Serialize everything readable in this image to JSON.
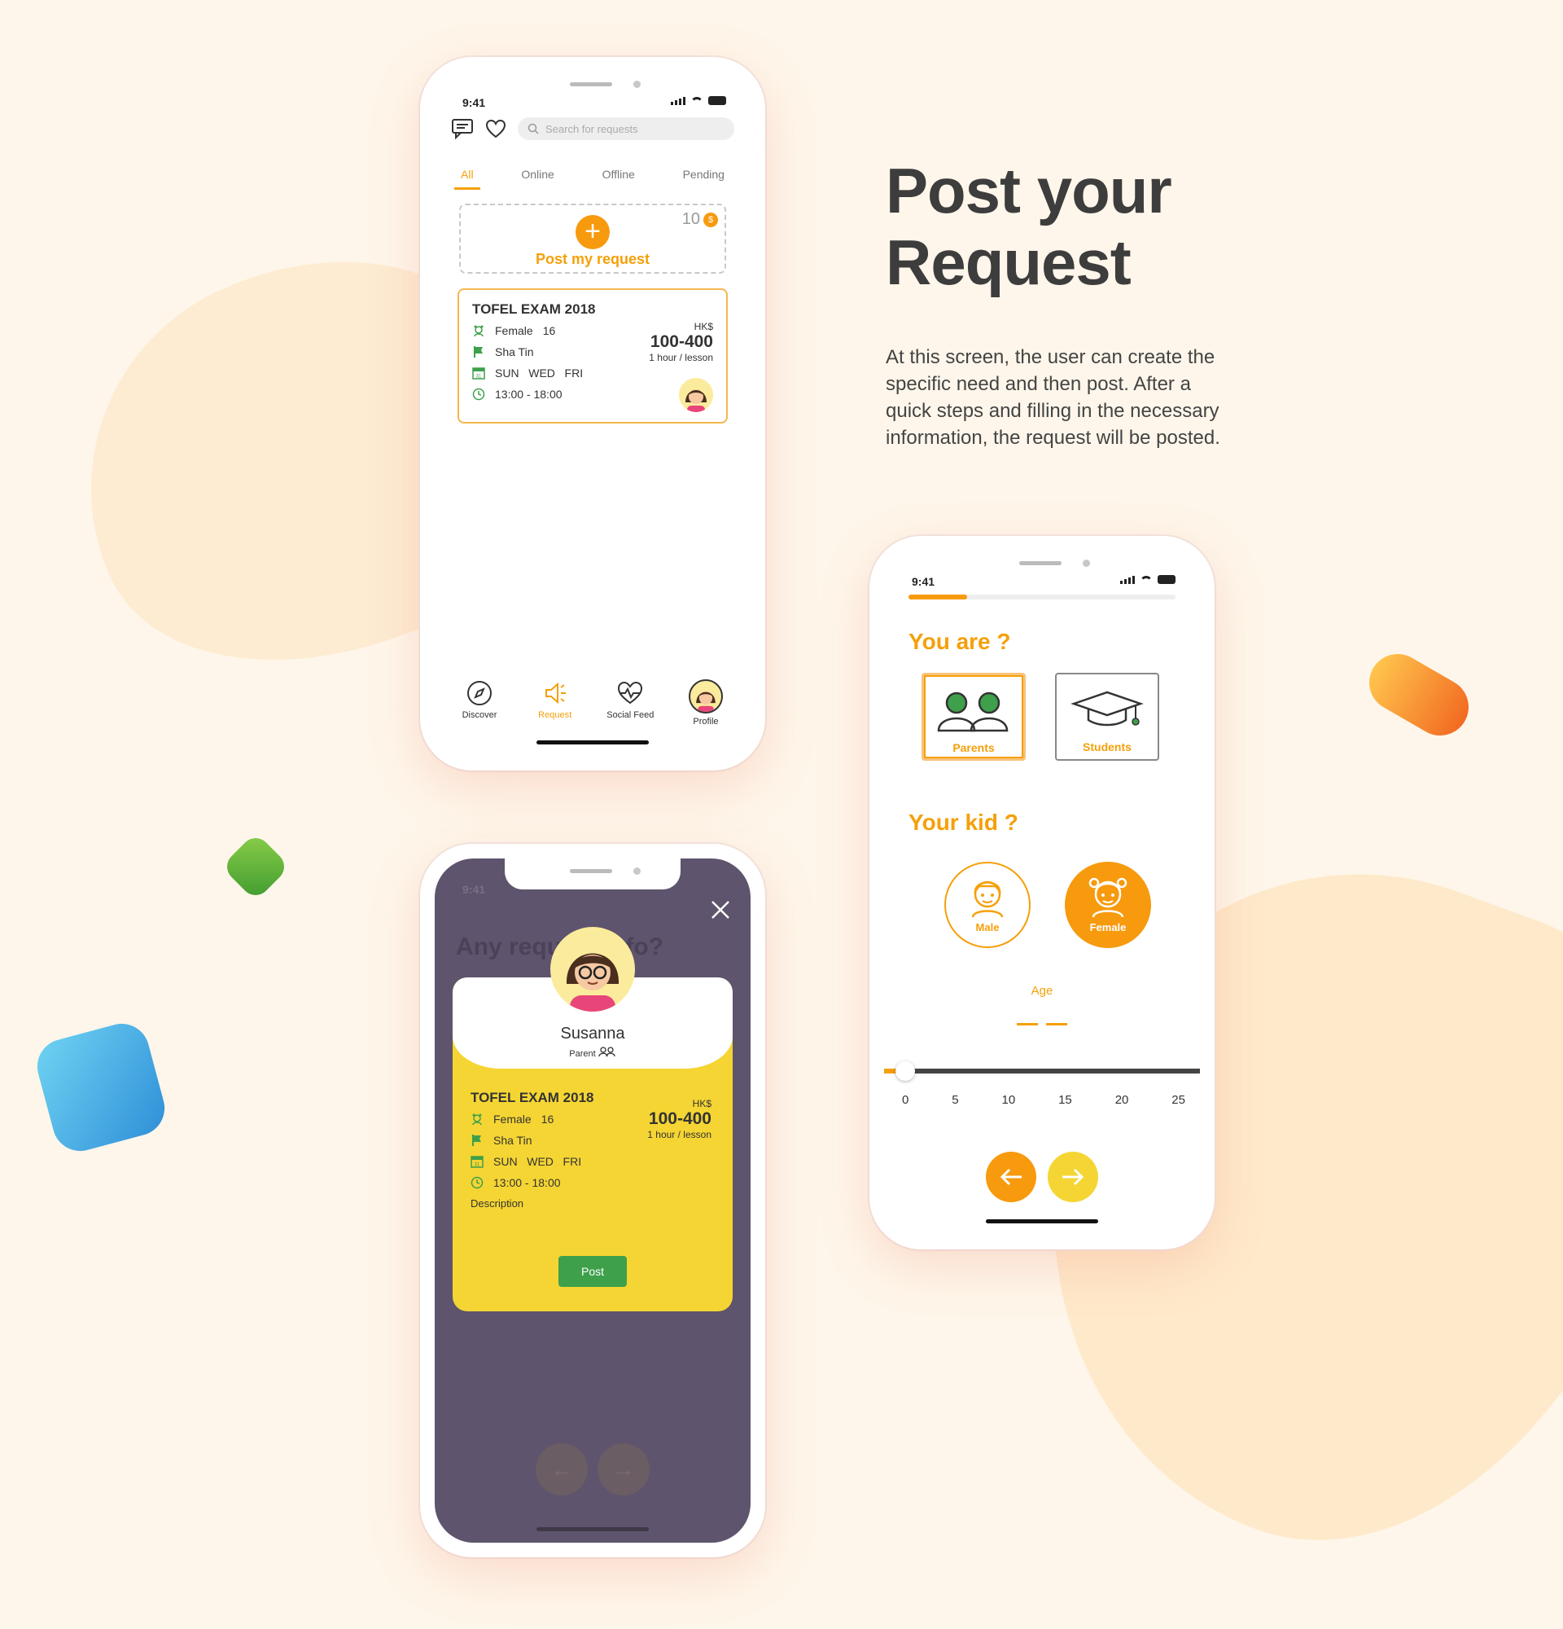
{
  "hero": {
    "title_line1": "Post your",
    "title_line2": "Request",
    "description": "At this screen, the user can create the specific need and then post. After a quick steps and filling in the necessary information, the request will be posted."
  },
  "status_time": "9:41",
  "phone_list": {
    "search_placeholder": "Search for requests",
    "tabs": [
      "All",
      "Online",
      "Offline",
      "Pending"
    ],
    "active_tab": "All",
    "post_label": "Post my request",
    "coin_count": "10",
    "coin_symbol": "$",
    "card": {
      "title": "TOFEL EXAM 2018",
      "gender": "Female",
      "age": "16",
      "location": "Sha Tin",
      "days": "SUN   WED   FRI",
      "hours": "13:00 - 18:00",
      "currency": "HK$",
      "price": "100-400",
      "unit": "1 hour / lesson"
    },
    "nav": [
      {
        "label": "Discover",
        "icon": "compass-icon"
      },
      {
        "label": "Request",
        "icon": "megaphone-icon"
      },
      {
        "label": "Social Feed",
        "icon": "heart-pulse-icon"
      },
      {
        "label": "Profile",
        "icon": "avatar"
      }
    ]
  },
  "phone_confirm": {
    "background_title": "Any request info?",
    "user_name": "Susanna",
    "user_role": "Parent",
    "card": {
      "title": "TOFEL EXAM 2018",
      "gender": "Female",
      "age": "16",
      "location": "Sha Tin",
      "days": "SUN   WED   FRI",
      "hours": "13:00 - 18:00",
      "currency": "HK$",
      "price": "100-400",
      "unit": "1 hour / lesson"
    },
    "description_label": "Description",
    "post_button": "Post"
  },
  "phone_form": {
    "progress": 0.22,
    "question_you": "You are ?",
    "options": [
      "Parents",
      "Students"
    ],
    "selected_option": "Parents",
    "question_kid": "Your kid ?",
    "kid_options": [
      "Male",
      "Female"
    ],
    "selected_kid": "Female",
    "age_label": "Age",
    "age_ticks": [
      "0",
      "5",
      "10",
      "15",
      "20",
      "25"
    ],
    "age_slider_value": 0
  },
  "colors": {
    "accent": "#f5a00a",
    "yellow": "#f5d533",
    "green": "#3ea04a",
    "modal_overlay": "#5e546d",
    "background": "#fef6ea"
  }
}
